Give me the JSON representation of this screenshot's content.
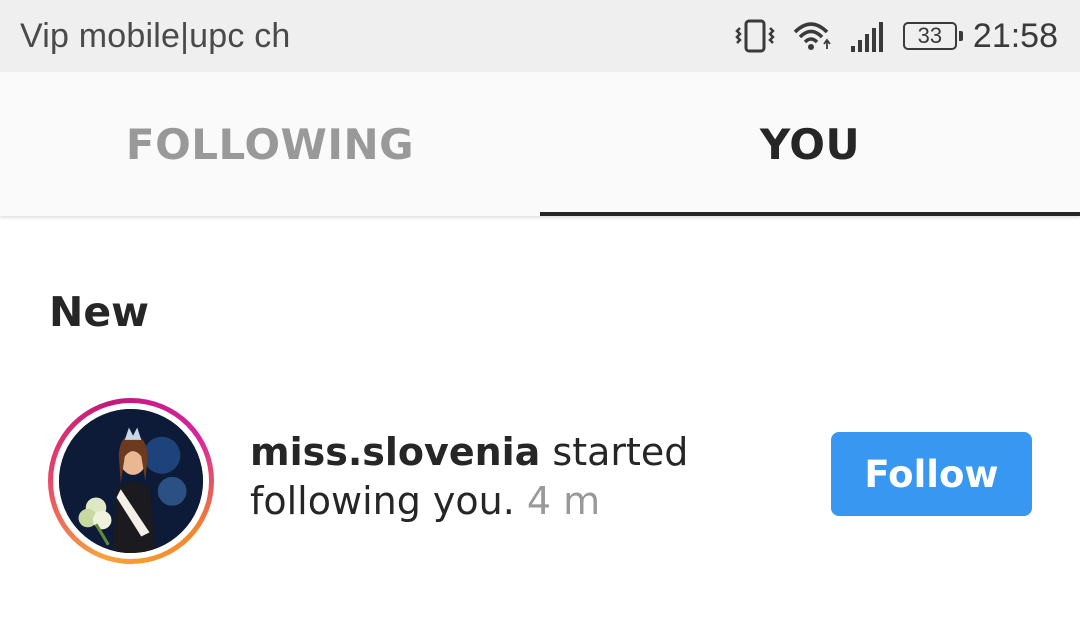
{
  "status_bar": {
    "carrier": "Vip mobile|upc ch",
    "battery": "33",
    "time": "21:58",
    "icons": [
      "vibrate-icon",
      "wifi-icon",
      "signal-icon",
      "battery-icon"
    ]
  },
  "tabs": [
    {
      "label": "FOLLOWING",
      "active": false
    },
    {
      "label": "YOU",
      "active": true
    }
  ],
  "section": {
    "title": "New"
  },
  "notification": {
    "username": "miss.slovenia",
    "action": " started following you.",
    "time": " 4 m",
    "button_label": "Follow"
  },
  "colors": {
    "accent": "#3897f0",
    "text_primary": "#262626",
    "text_secondary": "#999999",
    "status_bar_bg": "#efefef"
  }
}
